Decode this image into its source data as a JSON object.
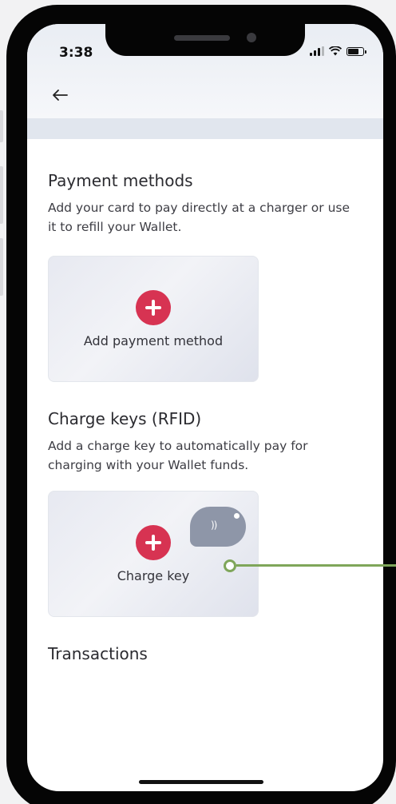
{
  "status_bar": {
    "time": "3:38"
  },
  "nav": {
    "back_icon": "arrow-left-icon"
  },
  "payment": {
    "title": "Payment methods",
    "description": "Add your card to pay directly at a charger or use it to refill your Wallet.",
    "add_label": "Add payment method"
  },
  "charge_keys": {
    "title": "Charge keys (RFID)",
    "description": "Add a charge key to automatically pay for charging with your Wallet funds.",
    "add_label": "Charge key"
  },
  "transactions": {
    "title": "Transactions"
  },
  "colors": {
    "accent": "#d73352",
    "callout": "#7fa65a",
    "rfid_tag": "#8e96a8"
  }
}
